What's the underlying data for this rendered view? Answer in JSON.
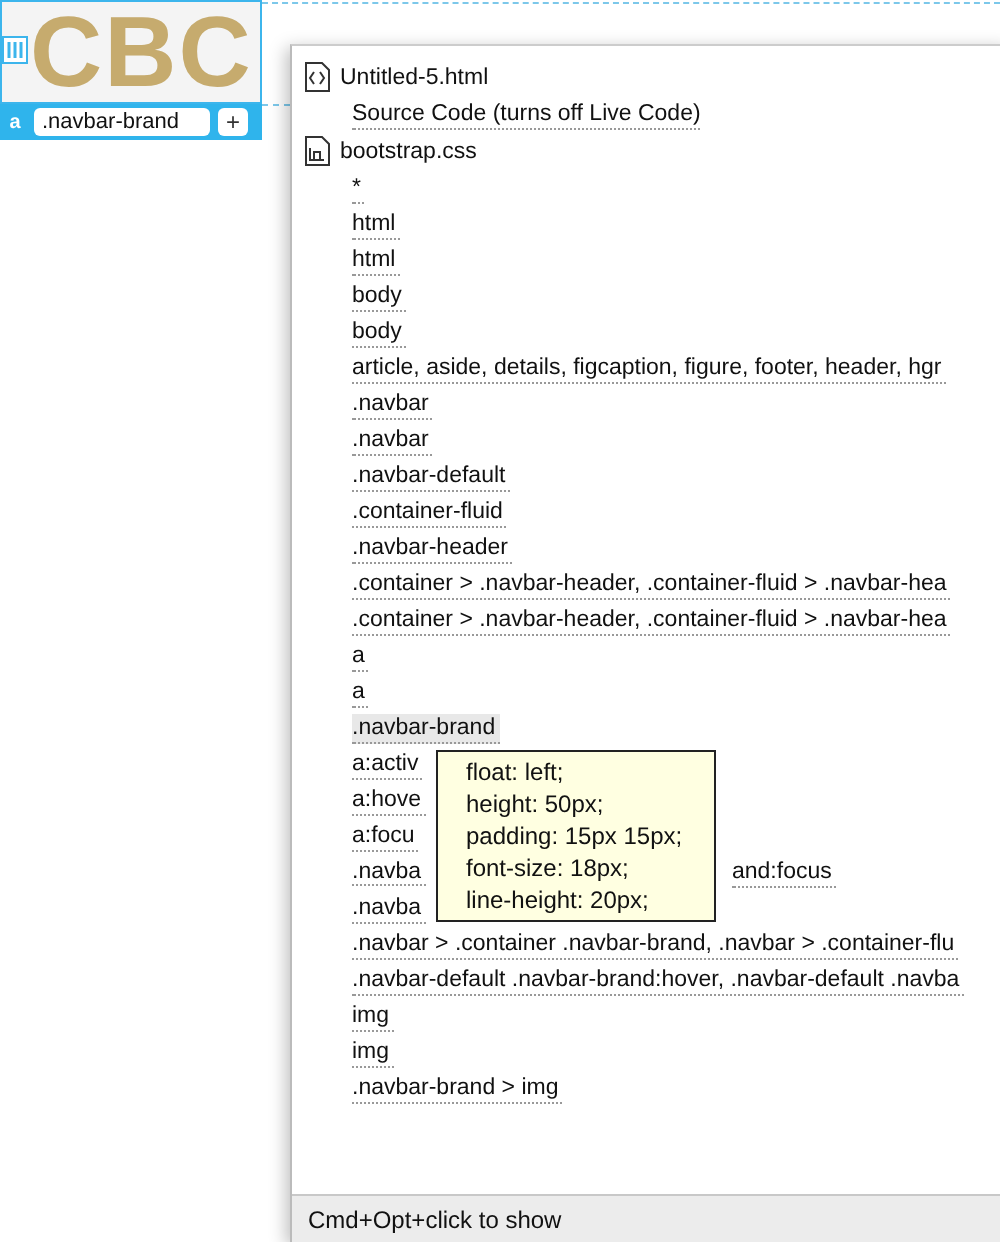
{
  "canvas": {
    "logo_text": "CBC",
    "element_tag": "a",
    "class_field": {
      "value": ".navbar-brand"
    },
    "add_button": "+"
  },
  "popup": {
    "items": [
      {
        "kind": "html_file",
        "label": "Untitled-5.html"
      },
      {
        "kind": "option",
        "label": "Source Code (turns off Live Code)"
      },
      {
        "kind": "css_file",
        "label": "bootstrap.css"
      },
      {
        "kind": "rule",
        "label": "*",
        "selected": false
      },
      {
        "kind": "rule",
        "label": "html",
        "selected": false
      },
      {
        "kind": "rule",
        "label": "html",
        "selected": false
      },
      {
        "kind": "rule",
        "label": "body",
        "selected": false
      },
      {
        "kind": "rule",
        "label": "body",
        "selected": false
      },
      {
        "kind": "rule",
        "label": "article, aside, details, figcaption, figure, footer, header, hgr",
        "selected": false
      },
      {
        "kind": "rule",
        "label": ".navbar",
        "selected": false
      },
      {
        "kind": "rule",
        "label": ".navbar",
        "selected": false
      },
      {
        "kind": "rule",
        "label": ".navbar-default",
        "selected": false
      },
      {
        "kind": "rule",
        "label": ".container-fluid",
        "selected": false
      },
      {
        "kind": "rule",
        "label": ".navbar-header",
        "selected": false
      },
      {
        "kind": "rule",
        "label": ".container > .navbar-header, .container-fluid > .navbar-hea",
        "selected": false
      },
      {
        "kind": "rule",
        "label": ".container > .navbar-header, .container-fluid > .navbar-hea",
        "selected": false
      },
      {
        "kind": "rule",
        "label": "a",
        "selected": false
      },
      {
        "kind": "rule",
        "label": "a",
        "selected": false
      },
      {
        "kind": "rule",
        "label": ".navbar-brand",
        "selected": true
      },
      {
        "kind": "rule",
        "label": "a:activ",
        "selected": false
      },
      {
        "kind": "rule",
        "label": "a:hove",
        "selected": false
      },
      {
        "kind": "rule",
        "label": "a:focu",
        "selected": false
      },
      {
        "kind": "rule",
        "label": ".navba",
        "label_right": "and:focus",
        "selected": false
      },
      {
        "kind": "rule",
        "label": ".navba",
        "selected": false
      },
      {
        "kind": "rule",
        "label": ".navbar > .container .navbar-brand, .navbar > .container-flu",
        "selected": false
      },
      {
        "kind": "rule",
        "label": ".navbar-default .navbar-brand:hover, .navbar-default .navba",
        "selected": false
      },
      {
        "kind": "rule",
        "label": "img",
        "selected": false
      },
      {
        "kind": "rule",
        "label": "img",
        "selected": false
      },
      {
        "kind": "rule",
        "label": ".navbar-brand > img",
        "selected": false
      }
    ],
    "tooltip": {
      "lines": [
        "float: left;",
        "height: 50px;",
        "padding: 15px 15px;",
        "font-size: 18px;",
        "line-height: 20px;"
      ]
    },
    "status_bar": "Cmd+Opt+click to show"
  }
}
